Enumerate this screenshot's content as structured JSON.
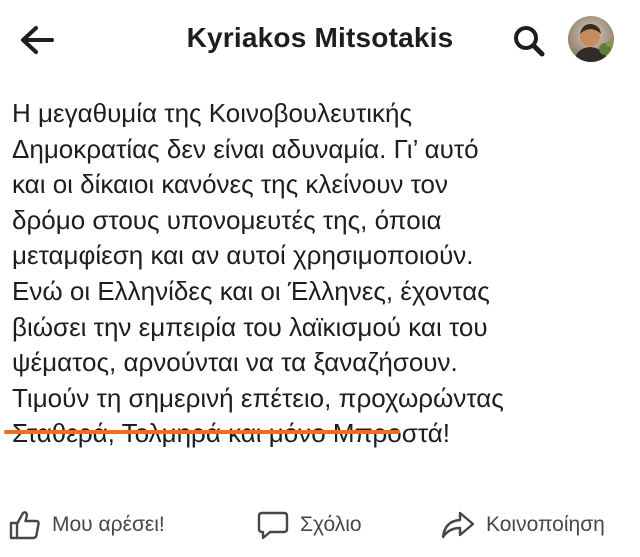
{
  "header": {
    "title": "Kyriakos Mitsotakis"
  },
  "post": {
    "lines": [
      "Η μεγαθυμία της Κοινοβουλευτικής",
      "Δημοκρατίας δεν είναι αδυναμία. Γι’ αυτό",
      "και οι δίκαιοι κανόνες της κλείνουν τον",
      "δρόμο στους υπονομευτές της, όποια",
      "μεταμφίεση και αν αυτοί χρησιμοποιούν.",
      "Ενώ οι Ελληνίδες και οι Έλληνες, έχοντας",
      "βιώσει την εμπειρία του λαϊκισμού και του",
      "ψέματος, αρνούνται να τα ξαναζήσουν."
    ],
    "highlight_text": "Τιμούν τη σημερινή επέτειο",
    "highlight_rest": ", προχωρώντας",
    "last_line": "Σταθερά, Τολμηρά και μόνο Μπροστά!",
    "highlight_color": "#f26d21"
  },
  "actions": {
    "like_label": "Μου αρέσει!",
    "comment_label": "Σχόλιο",
    "share_label": "Κοινοποίηση"
  },
  "icons": {
    "back": "back-arrow-icon",
    "search": "search-icon",
    "avatar": "profile-avatar",
    "like": "thumbs-up-icon",
    "comment": "comment-icon",
    "share": "share-icon"
  }
}
